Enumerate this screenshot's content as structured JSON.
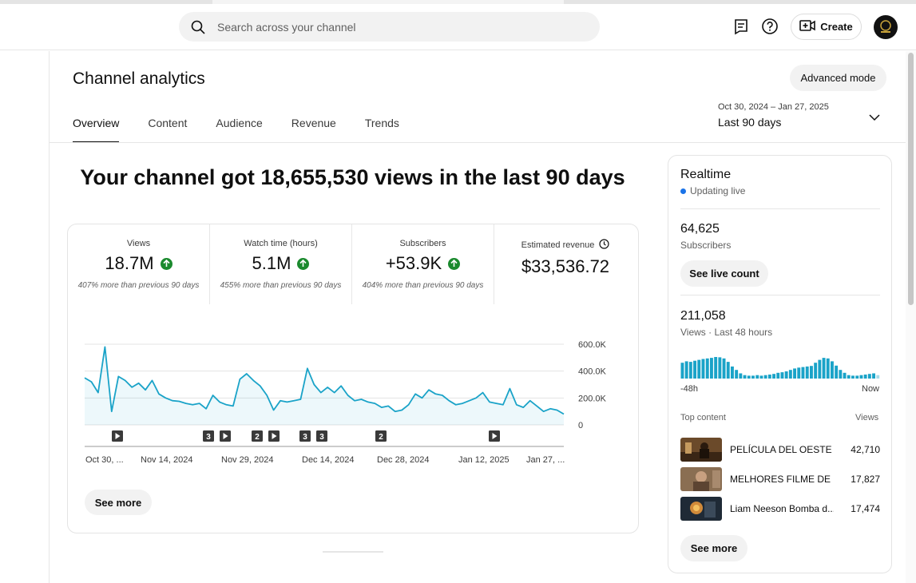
{
  "header": {
    "search_placeholder": "Search across your channel",
    "create_label": "Create",
    "icons": [
      "search-icon",
      "feedback-icon",
      "help-icon",
      "create-video-icon",
      "avatar"
    ]
  },
  "page": {
    "title": "Channel analytics",
    "advanced_mode_label": "Advanced mode",
    "tabs": [
      {
        "label": "Overview",
        "active": true
      },
      {
        "label": "Content",
        "active": false
      },
      {
        "label": "Audience",
        "active": false
      },
      {
        "label": "Revenue",
        "active": false
      },
      {
        "label": "Trends",
        "active": false
      }
    ],
    "date_range": "Oct 30, 2024 – Jan 27, 2025",
    "date_label": "Last 90 days"
  },
  "overview": {
    "headline": "Your channel got 18,655,530 views in the last 90 days",
    "metrics": [
      {
        "label": "Views",
        "value": "18.7M",
        "note": "407% more than previous 90 days",
        "trend": "up"
      },
      {
        "label": "Watch time (hours)",
        "value": "5.1M",
        "note": "455% more than previous 90 days",
        "trend": "up"
      },
      {
        "label": "Subscribers",
        "value": "+53.9K",
        "note": "404% more than previous 90 days",
        "trend": "up"
      },
      {
        "label": "Estimated revenue",
        "value": "$33,536.72",
        "note": "",
        "trend": "none"
      }
    ],
    "see_more_label": "See more"
  },
  "chart_data": {
    "type": "area",
    "ylim": [
      0,
      600000
    ],
    "y_ticks": [
      "600.0K",
      "400.0K",
      "200.0K",
      "0"
    ],
    "x_tick_labels": [
      "Oct 30, ...",
      "Nov 14, 2024",
      "Nov 29, 2024",
      "Dec 14, 2024",
      "Dec 28, 2024",
      "Jan 12, 2025",
      "Jan 27, ..."
    ],
    "series": [
      {
        "values": [
          350000,
          320000,
          240000,
          580000,
          100000,
          360000,
          330000,
          280000,
          310000,
          260000,
          330000,
          230000,
          200000,
          180000,
          175000,
          160000,
          150000,
          160000,
          120000,
          220000,
          170000,
          150000,
          140000,
          340000,
          380000,
          330000,
          290000,
          220000,
          110000,
          180000,
          170000,
          180000,
          190000,
          420000,
          300000,
          240000,
          280000,
          240000,
          290000,
          220000,
          180000,
          190000,
          170000,
          160000,
          130000,
          140000,
          100000,
          110000,
          150000,
          230000,
          200000,
          260000,
          230000,
          220000,
          180000,
          150000,
          160000,
          180000,
          200000,
          240000,
          170000,
          160000,
          150000,
          270000,
          150000,
          130000,
          180000,
          140000,
          100000,
          120000,
          110000,
          80000
        ]
      }
    ],
    "markers": [
      "play",
      "3",
      "play",
      "2",
      "play",
      "3",
      "3",
      "2",
      "play"
    ]
  },
  "realtime": {
    "title": "Realtime",
    "live_label": "Updating live",
    "subscribers_value": "64,625",
    "subscribers_label": "Subscribers",
    "live_count_label": "See live count",
    "views_value": "211,058",
    "views_label": "Views · Last 48 hours",
    "axis_start": "-48h",
    "axis_end": "Now",
    "bars": [
      0.55,
      0.6,
      0.58,
      0.62,
      0.65,
      0.68,
      0.7,
      0.72,
      0.75,
      0.74,
      0.7,
      0.58,
      0.42,
      0.3,
      0.18,
      0.12,
      0.1,
      0.1,
      0.12,
      0.1,
      0.12,
      0.14,
      0.16,
      0.2,
      0.22,
      0.25,
      0.3,
      0.35,
      0.38,
      0.4,
      0.42,
      0.44,
      0.55,
      0.65,
      0.72,
      0.7,
      0.6,
      0.45,
      0.3,
      0.2,
      0.12,
      0.1,
      0.1,
      0.12,
      0.14,
      0.16,
      0.18,
      0.12
    ],
    "top_content_label": "Top content",
    "views_col_label": "Views",
    "top_content": [
      {
        "title": "PELÍCULA DEL OESTE ...",
        "views": "42,710"
      },
      {
        "title": "MELHORES FILME DE ...",
        "views": "17,827"
      },
      {
        "title": "Liam Neeson Bomba d...",
        "views": "17,474"
      }
    ],
    "see_more_label": "See more"
  },
  "colors": {
    "accent_blue": "#1aa3c8",
    "trend_up_green": "#1b8a2e",
    "live_dot": "#1a73e8"
  }
}
